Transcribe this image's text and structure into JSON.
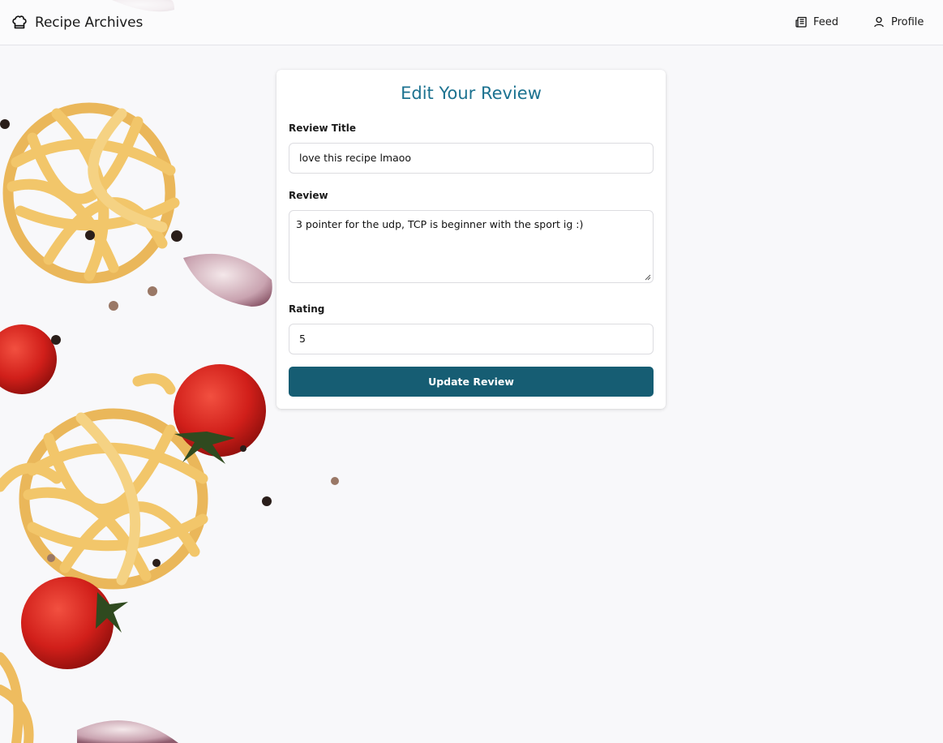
{
  "navbar": {
    "brand_icon": "chef-hat-icon",
    "brand_title": "Recipe Archives",
    "items": [
      {
        "label": "Feed",
        "icon": "newspaper-icon"
      },
      {
        "label": "Profile",
        "icon": "user-icon"
      }
    ]
  },
  "form": {
    "heading": "Edit Your Review",
    "title_label": "Review Title",
    "title_value": "love this recipe lmaoo",
    "review_label": "Review",
    "review_value": "3 pointer for the udp, TCP is beginner with the sport ig :)",
    "rating_label": "Rating",
    "rating_value": "5",
    "submit_label": "Update Review"
  },
  "colors": {
    "heading": "#1c7290",
    "button": "#165d73",
    "background": "#f8f8fa"
  },
  "background_image": "pasta-tomatoes-garlic-photo"
}
